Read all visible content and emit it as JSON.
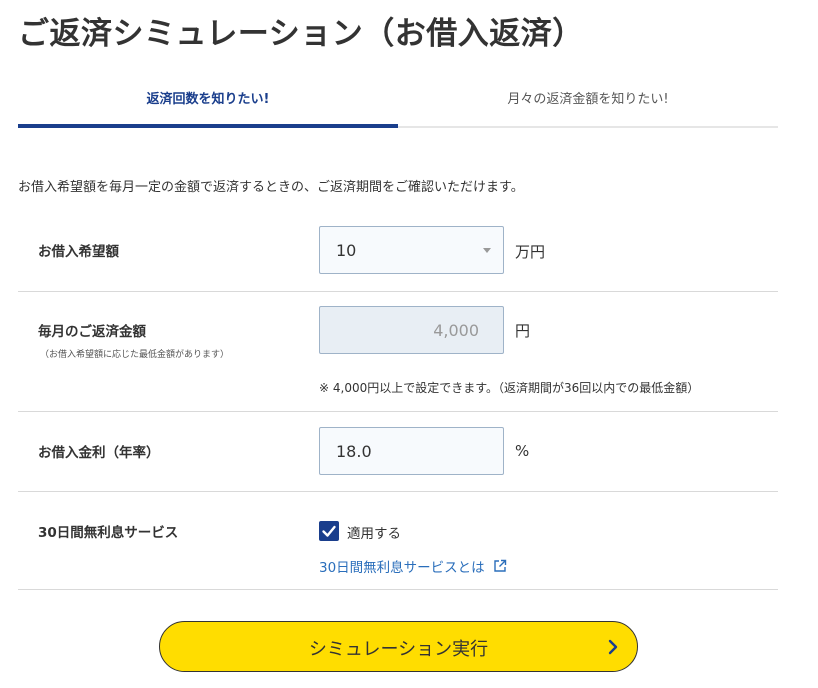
{
  "page": {
    "title": "ご返済シミュレーション（お借入返済）"
  },
  "tabs": [
    {
      "label": "返済回数を知りたい!",
      "active": true
    },
    {
      "label": "月々の返済金額を知りたい!",
      "active": false
    }
  ],
  "description": "お借入希望額を毎月一定の金額で返済するときの、ご返済期間をご確認いただけます。",
  "form": {
    "loan_amount": {
      "label": "お借入希望額",
      "value": "10",
      "unit": "万円"
    },
    "monthly_payment": {
      "label": "毎月のご返済金額",
      "sublabel": "（お借入希望額に応じた最低金額があります）",
      "value": "4,000",
      "unit": "円",
      "note": "※ 4,000円以上で設定できます。（返済期間が36回以内での最低金額）"
    },
    "interest_rate": {
      "label": "お借入金利（年率）",
      "value": "18.0",
      "unit": "%"
    },
    "interest_free": {
      "label": "30日間無利息サービス",
      "checkbox_label": "適用する",
      "checked": true,
      "link_text": "30日間無利息サービスとは"
    }
  },
  "cta": {
    "label": "シミュレーション実行"
  },
  "colors": {
    "accent": "#1a3e8c",
    "link": "#2a6ebb",
    "button": "#ffdd00"
  },
  "icons": [
    "caret-down-icon",
    "checkmark-icon",
    "external-link-icon",
    "chevron-right-icon"
  ]
}
